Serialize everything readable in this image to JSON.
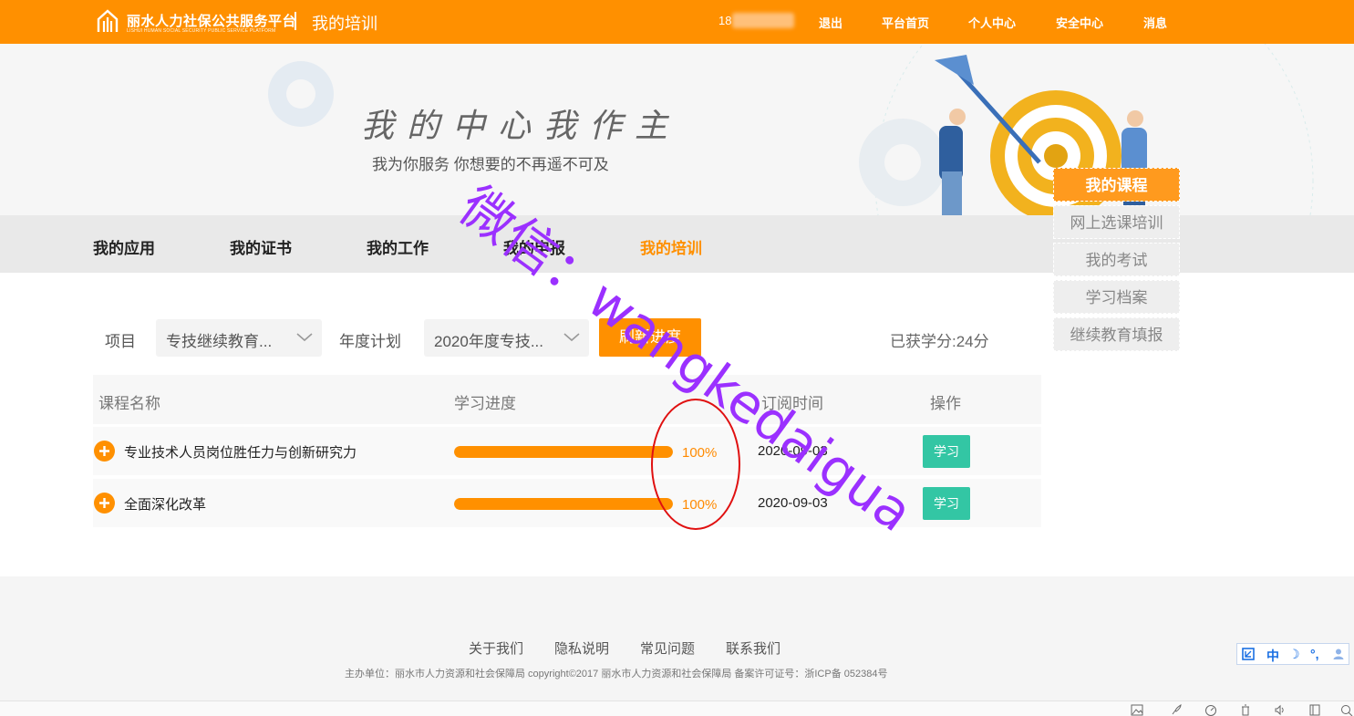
{
  "header": {
    "brand": "丽水人力社保公共服务平台",
    "brand_sub": "LISHUI HUMAN SOCIAL SECURITY PUBLIC SERVICE PLATFORM",
    "page_name": "我的培训",
    "user_id_prefix": "18",
    "links": [
      "退出",
      "平台首页",
      "个人中心",
      "安全中心",
      "消息"
    ]
  },
  "banner": {
    "title": "我的中心我作主",
    "subtitle": "我为你服务 你想要的不再遥不可及"
  },
  "tabs": [
    "我的应用",
    "我的证书",
    "我的工作",
    "我的申报",
    "我的培训"
  ],
  "active_tab": "我的培训",
  "side_menu": [
    "我的课程",
    "网上选课培训",
    "我的考试",
    "学习档案",
    "继续教育填报"
  ],
  "filters": {
    "project_label": "项目",
    "project_value": "专技继续教育...",
    "plan_label": "年度计划",
    "plan_value": "2020年度专技...",
    "query_button": "刷新进度",
    "credits": "已获学分:24分"
  },
  "table": {
    "headers": [
      "课程名称",
      "学习进度",
      "订阅时间",
      "操作"
    ],
    "rows": [
      {
        "name": "专业技术人员岗位胜任力与创新研究力",
        "progress": 100,
        "progress_text": "100%",
        "date": "2020-09-03",
        "action": "学习"
      },
      {
        "name": "全面深化改革",
        "progress": 100,
        "progress_text": "100%",
        "date": "2020-09-03",
        "action": "学习"
      }
    ]
  },
  "watermark": "微信：wangkedaigua",
  "footer": {
    "links": [
      "关于我们",
      "隐私说明",
      "常见问题",
      "联系我们"
    ],
    "copyright": "主办单位：丽水市人力资源和社会保障局 copyright©2017 丽水市人力资源和社会保障局 备案许可证号：浙ICP备 052384号"
  },
  "ime": {
    "lang": "中",
    "moon": "☽",
    "punct": "°,"
  },
  "colors": {
    "accent": "#ff9000",
    "learn_button": "#33c6a4",
    "annotation": "#e01010",
    "watermark": "#9b30ff"
  }
}
